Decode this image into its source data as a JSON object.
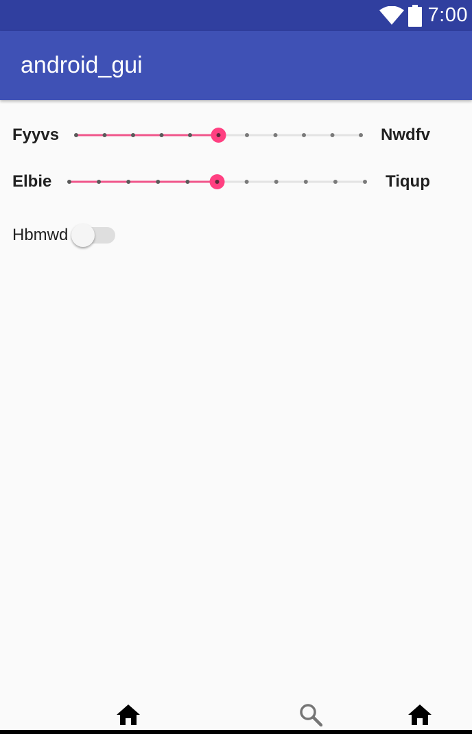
{
  "status_bar": {
    "time": "7:00",
    "icons": [
      "wifi-icon",
      "battery-icon"
    ]
  },
  "app_bar": {
    "title": "android_gui"
  },
  "sliders": [
    {
      "left_label": "Fyyvs",
      "right_label": "Nwdfv",
      "steps": 10,
      "value": 5
    },
    {
      "left_label": "Elbie",
      "right_label": "Tiqup",
      "steps": 10,
      "value": 5
    }
  ],
  "switch": {
    "label": "Hbmwd",
    "checked": false
  },
  "bottom_nav": {
    "items": [
      "home-icon",
      "search-icon",
      "home-icon"
    ]
  },
  "colors": {
    "status_bar": "#303f9f",
    "app_bar": "#3f51b5",
    "accent": "#ff4081",
    "active_track": "#f0558a"
  }
}
